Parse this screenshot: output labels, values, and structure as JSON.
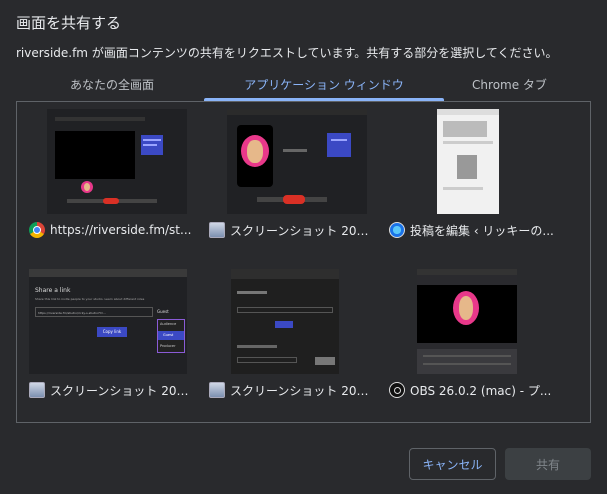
{
  "dialog": {
    "title": "画面を共有する",
    "subtitle": "riverside.fm が画面コンテンツの共有をリクエストしています。共有する部分を選択してください。"
  },
  "tabs": [
    {
      "label": "あなたの全画面"
    },
    {
      "label": "アプリケーション ウィンドウ"
    },
    {
      "label": "Chrome タブ"
    }
  ],
  "active_tab": 1,
  "windows": [
    {
      "label": "https://riverside.fm/st...",
      "icon": "chrome-icon"
    },
    {
      "label": "スクリーンショット 202...",
      "icon": "preview-icon"
    },
    {
      "label": "投稿を編集 ‹ リッキーの...",
      "icon": "safari-icon"
    },
    {
      "label": "スクリーンショット 202...",
      "icon": "preview-icon"
    },
    {
      "label": "スクリーンショット 202...",
      "icon": "preview-icon"
    },
    {
      "label": "OBS 26.0.2 (mac) - プ...",
      "icon": "obs-icon"
    }
  ],
  "thumb_text": {
    "share_title": "Share a link",
    "share_desc": "Share this link to invite people to your studio. Learn about different roles",
    "share_url": "https://riverside.fm/studio/ricky-s-studio?t=...",
    "role_selected": "Guest",
    "roles": [
      "Audience",
      "Guest",
      "Producer"
    ],
    "copy_btn": "Copy link"
  },
  "buttons": {
    "cancel": "キャンセル",
    "share": "共有"
  },
  "colors": {
    "background": "#292a2d",
    "accent": "#8ab4f8",
    "border": "#5f6368",
    "disabled_bg": "#3c4043"
  }
}
